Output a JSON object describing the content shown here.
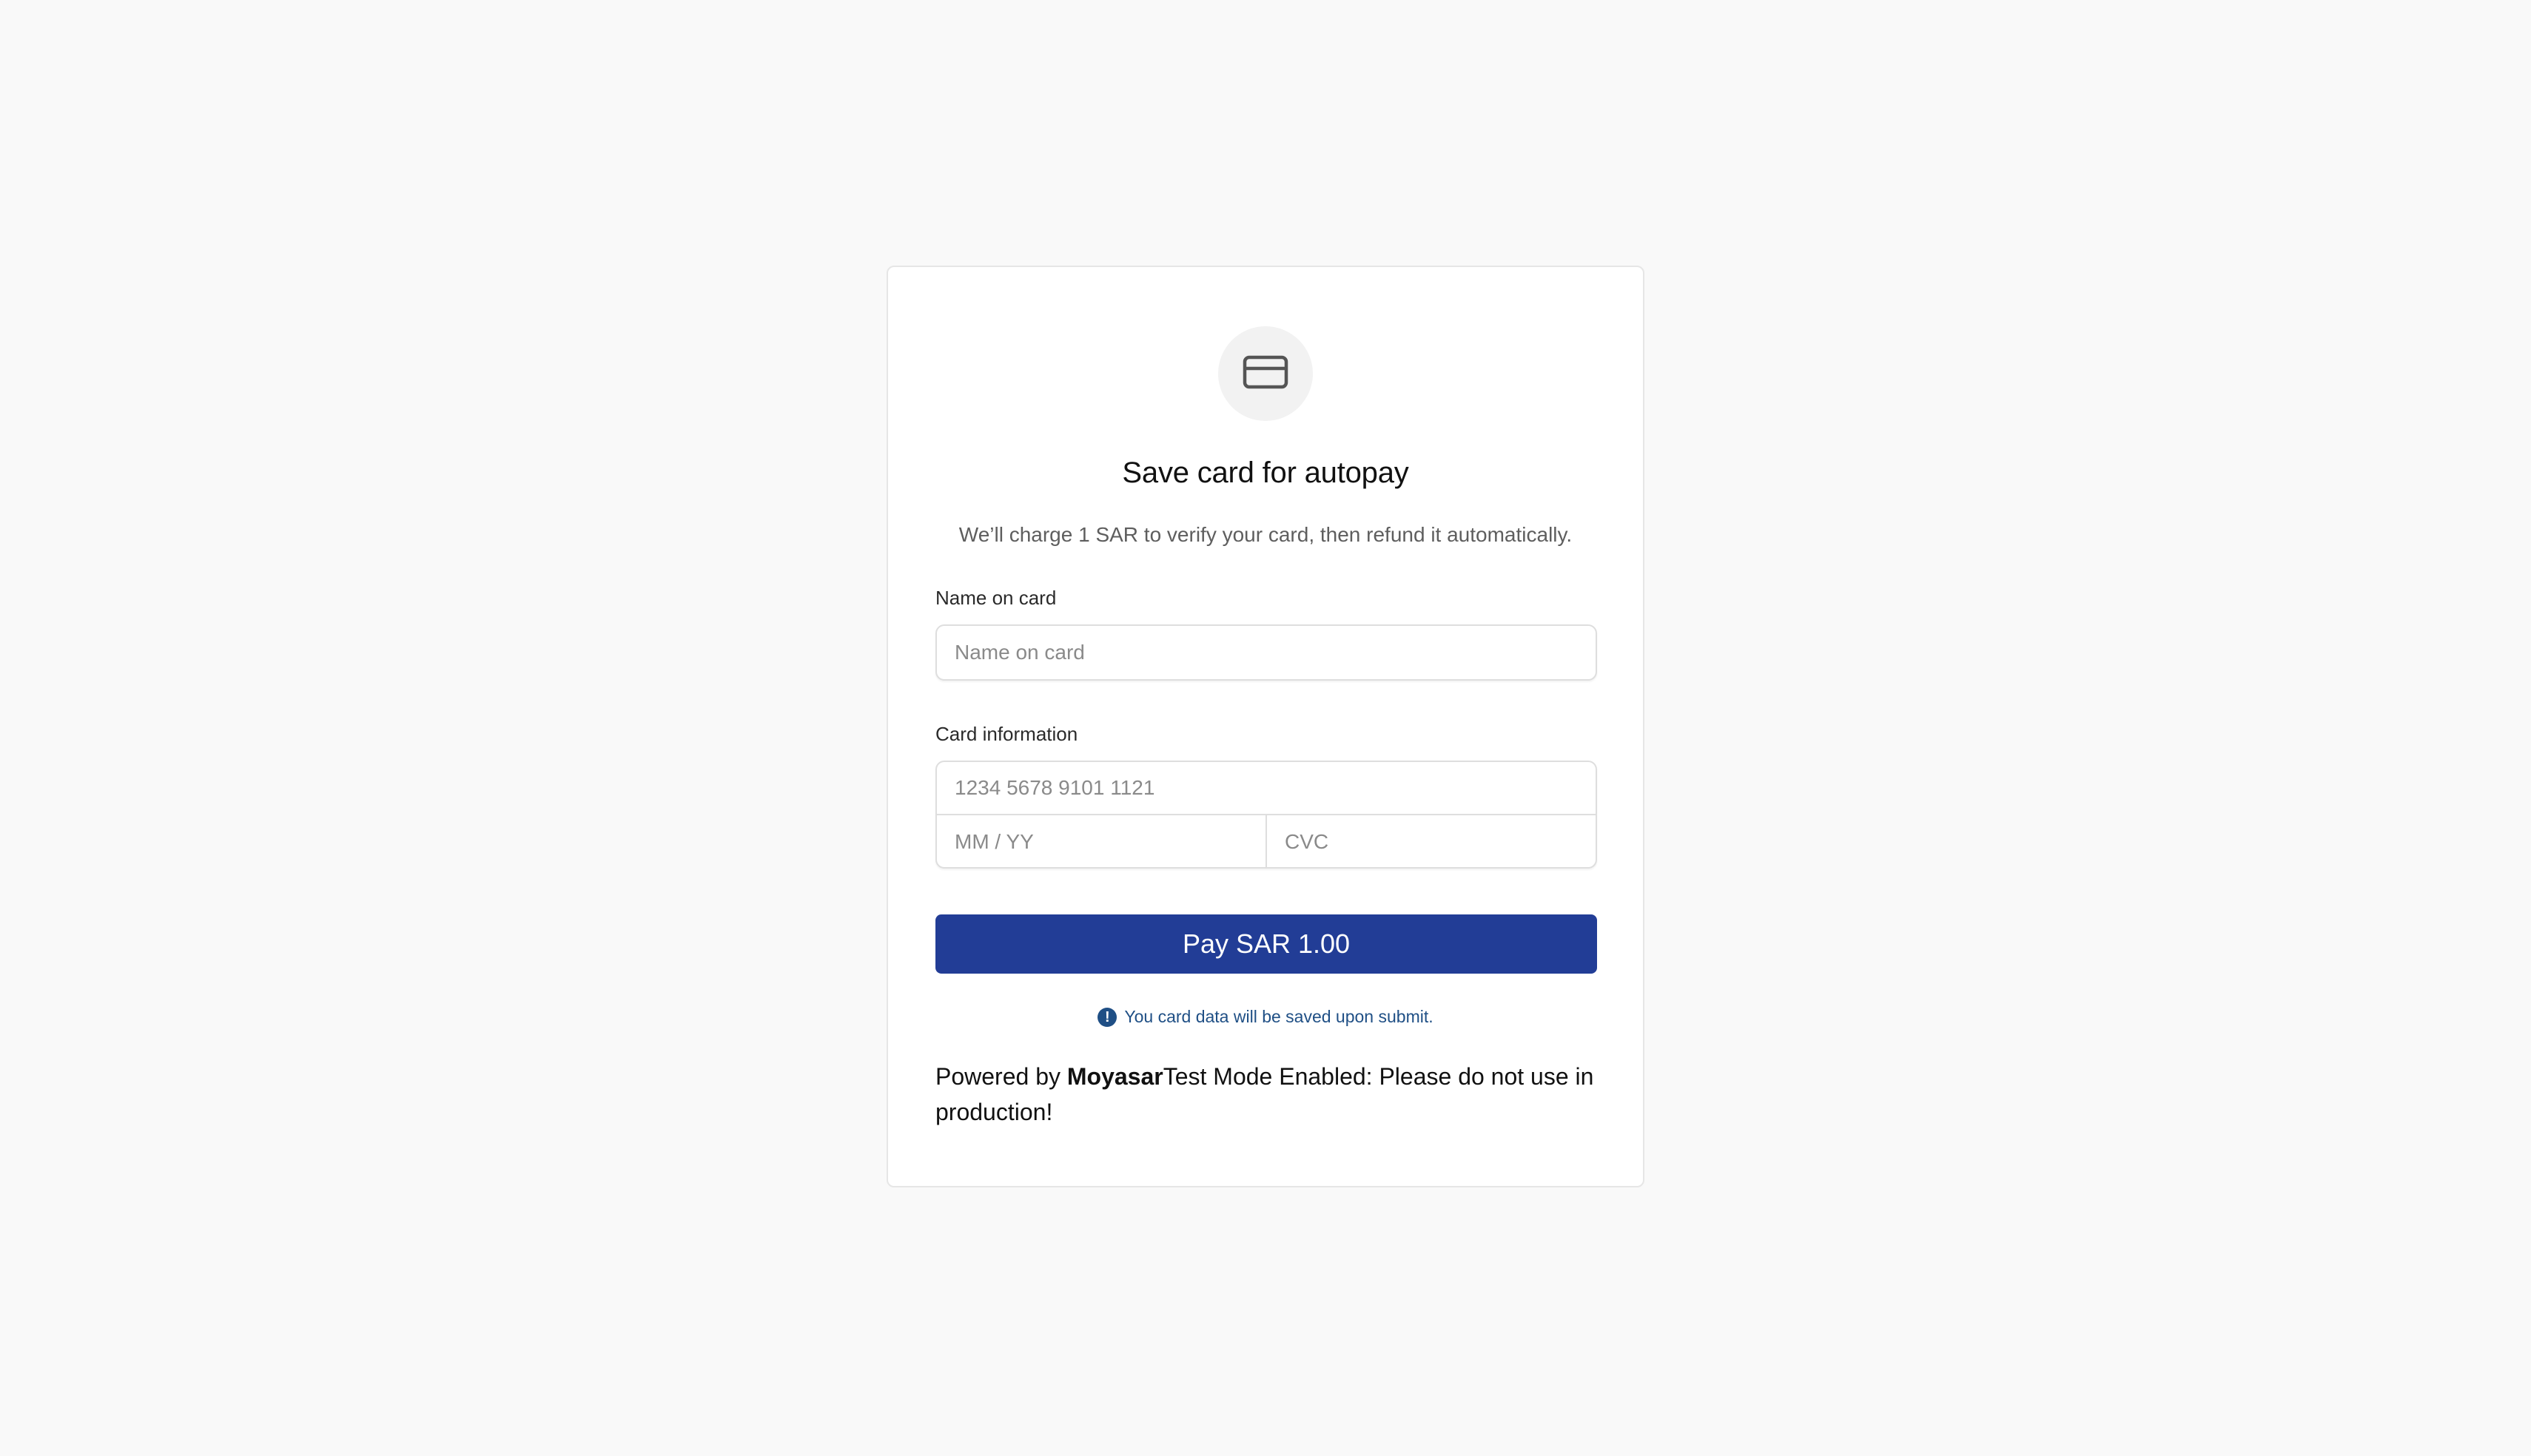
{
  "card": {
    "icon": "credit-card-icon",
    "title": "Save card for autopay",
    "subtitle": "We’ll charge 1 SAR to verify your card, then refund it automatically."
  },
  "form": {
    "name_label": "Name on card",
    "name_placeholder": "Name on card",
    "card_label": "Card information",
    "card_number_placeholder": "1234 5678 9101 1121",
    "expiry_placeholder": "MM / YY",
    "cvc_placeholder": "CVC"
  },
  "pay_button": {
    "label": "Pay SAR 1.00",
    "color": "#223d96"
  },
  "notice": {
    "icon": "info-icon",
    "text": "You card data will be saved upon submit."
  },
  "footer": {
    "powered_by": "Powered by ",
    "brand": "Moyasar",
    "test_mode": "Test Mode Enabled: Please do not use in production!"
  }
}
